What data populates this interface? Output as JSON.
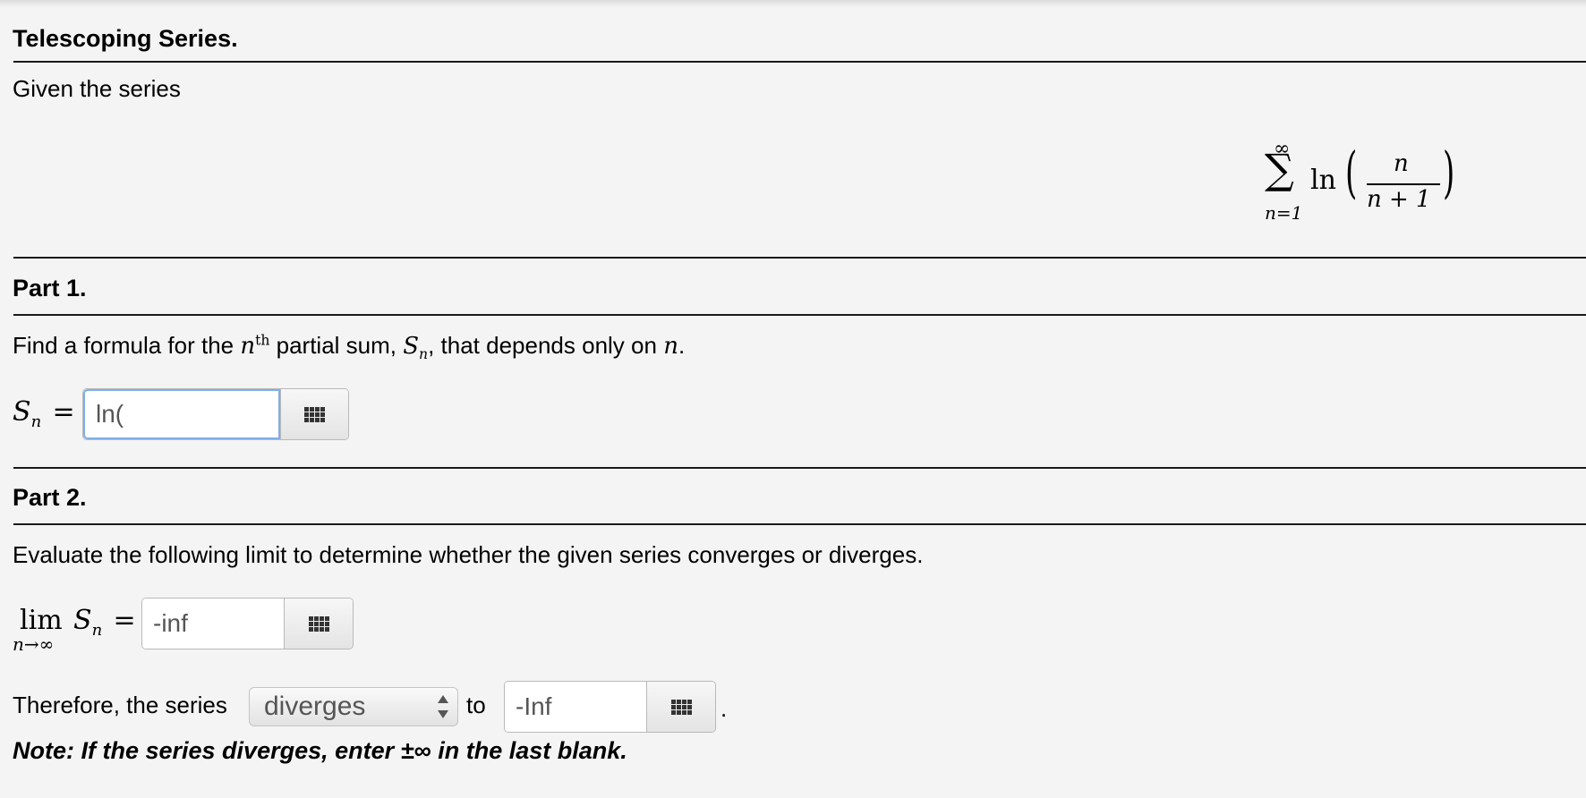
{
  "title": "Telescoping Series.",
  "intro": "Given the series",
  "series_formula": {
    "sum_upper": "∞",
    "sum_symbol": "∑",
    "sum_lower": "n=1",
    "func": "ln",
    "numerator": "n",
    "denominator": "n + 1"
  },
  "part1": {
    "heading": "Part 1.",
    "prompt_pre": "Find a formula for the ",
    "prompt_n": "n",
    "prompt_th": "th",
    "prompt_mid": " partial sum, ",
    "prompt_S": "S",
    "prompt_sub": "n",
    "prompt_post": ", that depends only on ",
    "prompt_n2": "n",
    "prompt_end": ".",
    "label_S": "S",
    "label_sub": "n",
    "label_eq": "=",
    "input_value": "ln("
  },
  "part2": {
    "heading": "Part 2.",
    "prompt": "Evaluate the following limit to determine whether the given series converges or diverges.",
    "lim": "lim",
    "lim_sub": "n→∞",
    "label_S": "S",
    "label_sub": "n",
    "label_eq": "=",
    "limit_value": "-inf",
    "therefore_text": "Therefore, the series",
    "select_value": "diverges",
    "to_text": "to",
    "final_value": "-Inf",
    "period": ".",
    "note": "Note: If the series diverges, enter ±∞ in the last blank."
  },
  "icons": {
    "matrix_button_icon": "grid-icon",
    "select_arrows_icon": "up-down-arrows-icon"
  },
  "colors": {
    "background": "#f4f4f4",
    "focus_border": "#7fb0e6"
  }
}
